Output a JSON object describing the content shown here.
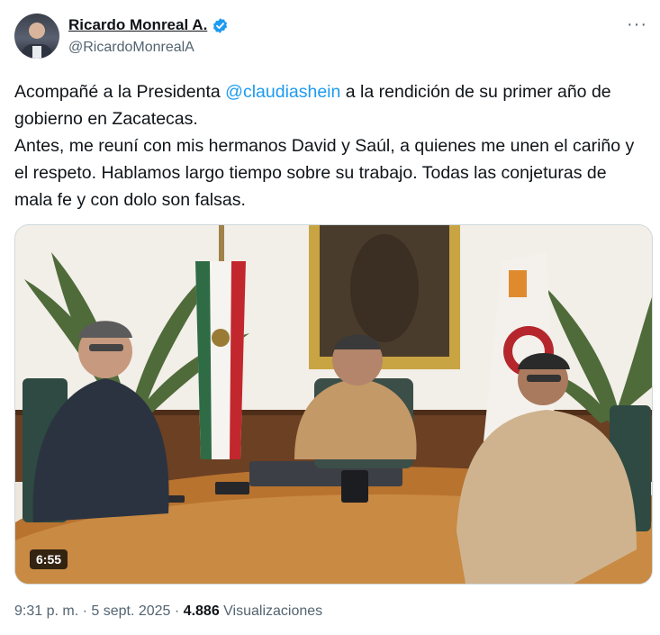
{
  "author": {
    "display_name": "Ricardo Monreal A.",
    "handle": "@RicardoMonrealA",
    "verified_badge": "verified-badge-icon",
    "accent_color": "#1d9bf0"
  },
  "menu": {
    "more_icon": "more-horizontal-icon",
    "more_label": "···"
  },
  "tweet": {
    "text_part1": "Acompañé a la Presidenta ",
    "mention": "@claudiashein",
    "text_part2": " a la rendición de su primer año de gobierno en Zacatecas.\nAntes, me reuní con mis hermanos David y Saúl, a quienes me unen el cariño y el respeto. Hablamos largo tiempo sobre su trabajo. Todas las conjeturas de mala fe y con dolo son falsas."
  },
  "media": {
    "type": "video",
    "duration": "6:55"
  },
  "meta": {
    "time": "9:31 p. m.",
    "sep1": " · ",
    "date": "5 sept. 2025",
    "sep2": " · ",
    "views_count": "4.886",
    "views_label": " Visualizaciones"
  }
}
